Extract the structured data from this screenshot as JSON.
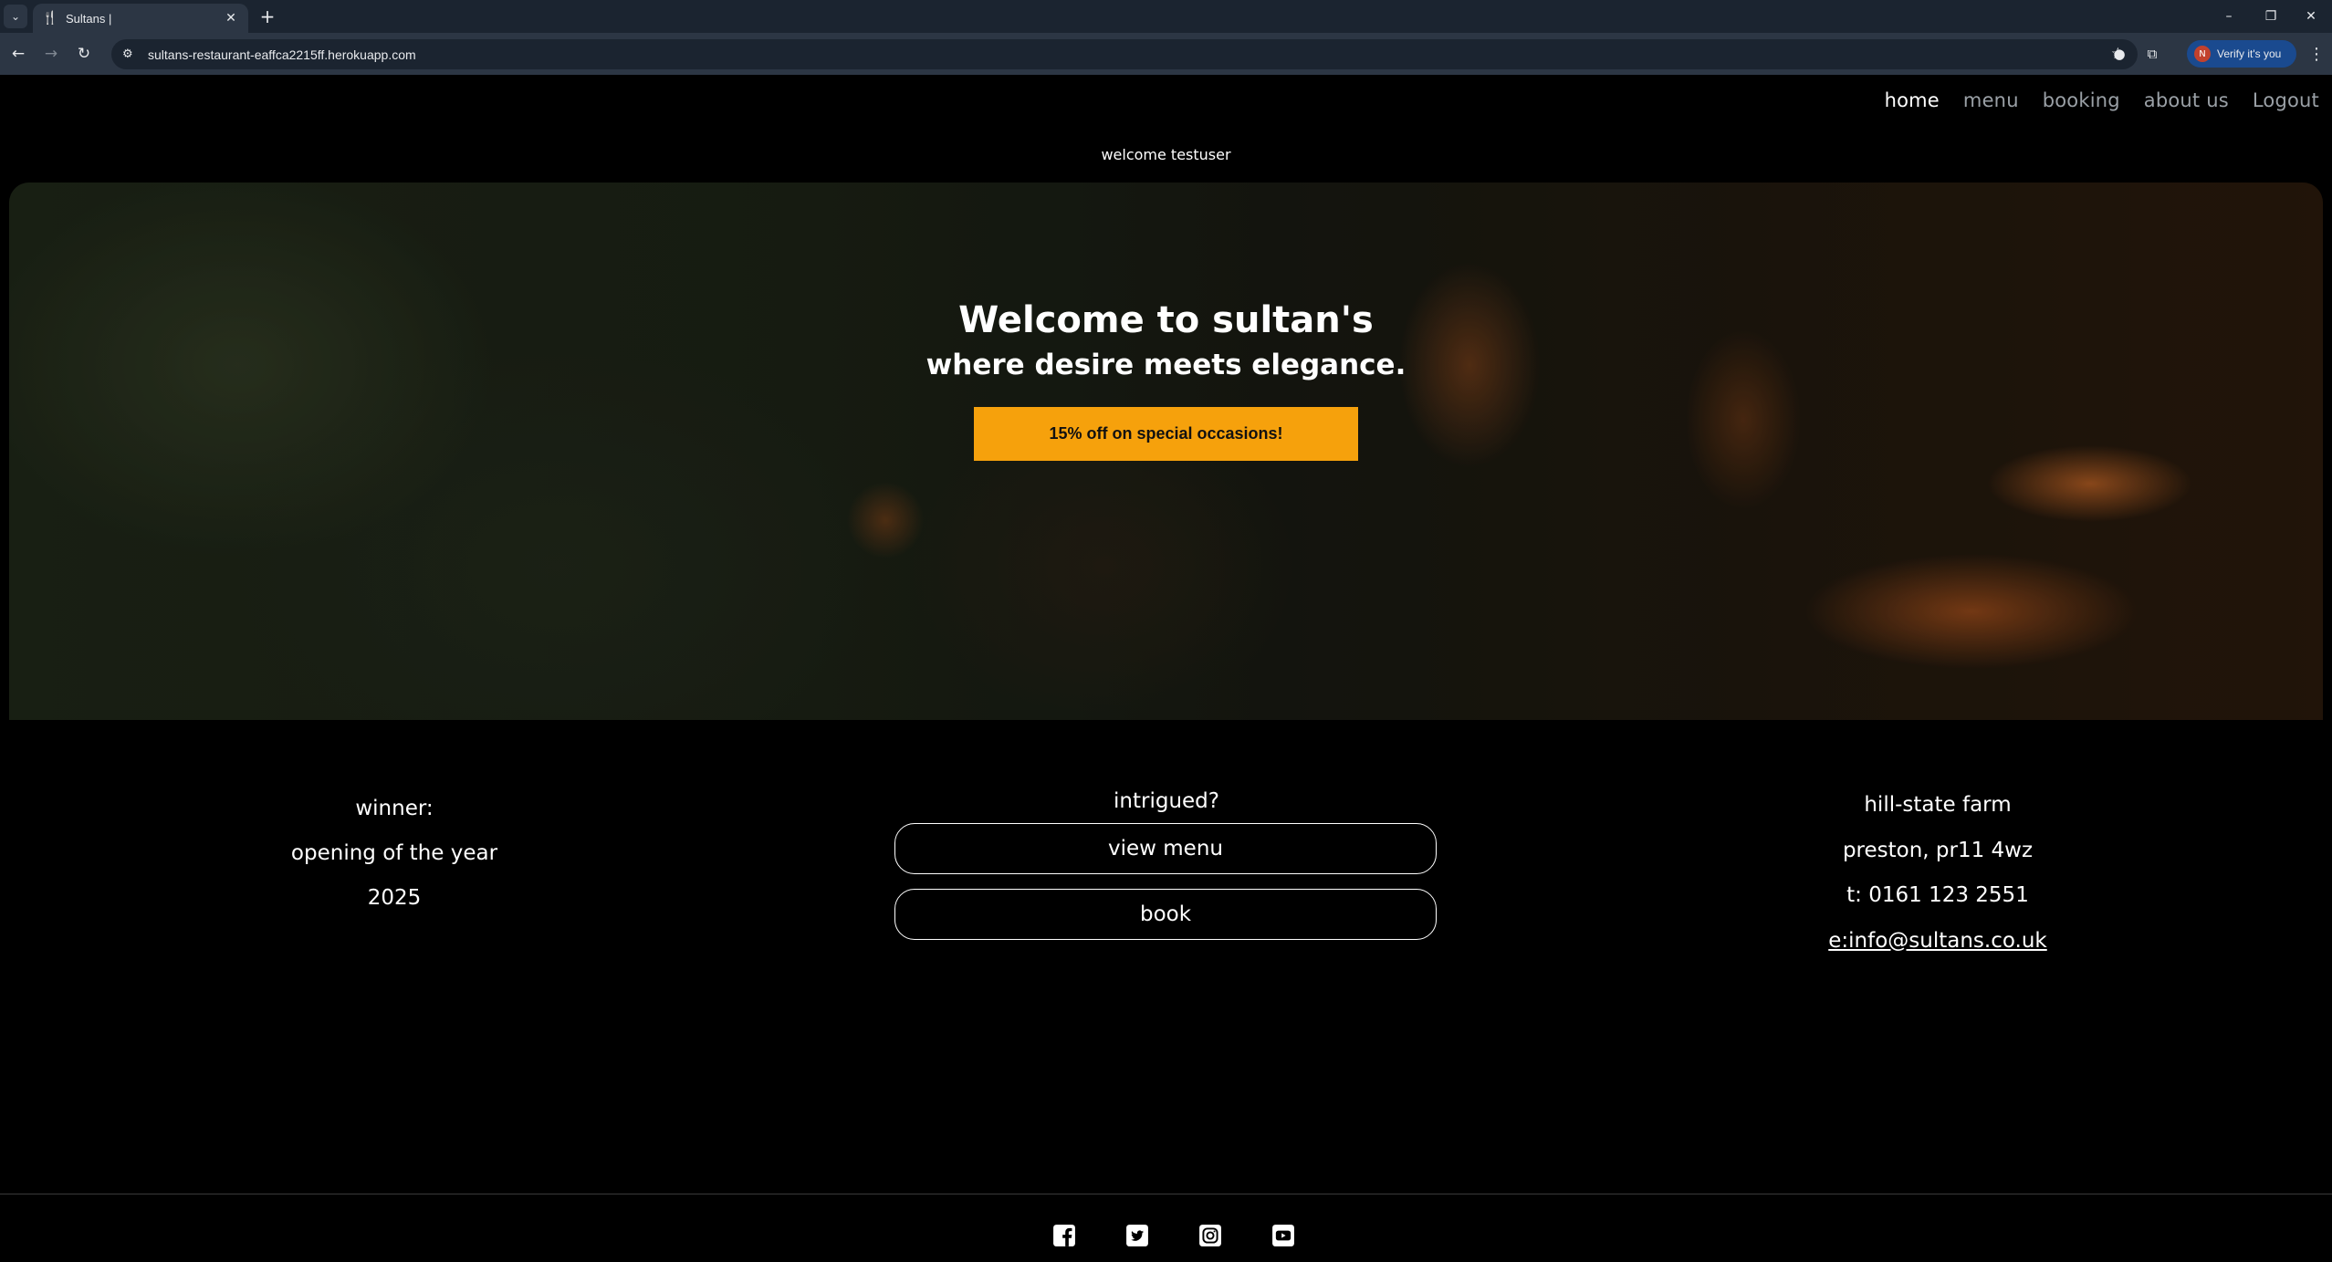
{
  "browser": {
    "tab_title": "Sultans |",
    "url": "sultans-restaurant-eaffca2215ff.herokuapp.com",
    "verify_label": "Verify it's you",
    "profile_initial": "N"
  },
  "nav": {
    "items": [
      "home",
      "menu",
      "booking",
      "about us",
      "Logout"
    ],
    "active": "home"
  },
  "welcome_user": "welcome testuser",
  "hero": {
    "title": "Welcome to sultan's",
    "subtitle": "where desire meets elegance.",
    "promo_label": "15% off on special occasions!",
    "promo_color": "#f6a10c"
  },
  "award": {
    "line1": "winner:",
    "line2": "opening of the year",
    "line3": "2025"
  },
  "cta": {
    "heading": "intrigued?",
    "view_menu": "view menu",
    "book": "book"
  },
  "contact": {
    "name": "hill-state farm",
    "address": "preston, pr11 4wz",
    "phone": "t: 0161 123 2551",
    "email": "e:info@sultans.co.uk"
  },
  "social_icons": [
    "facebook-icon",
    "twitter-icon",
    "instagram-icon",
    "youtube-icon"
  ]
}
